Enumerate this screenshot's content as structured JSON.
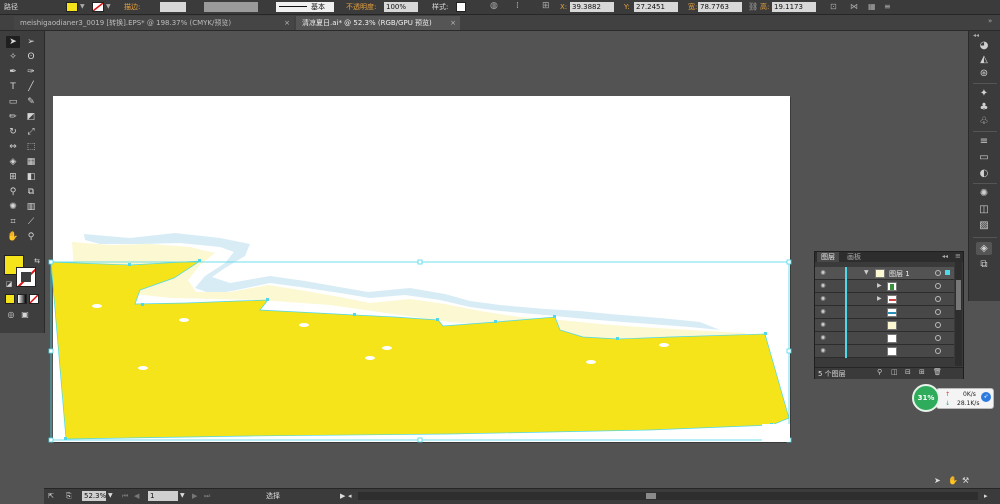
{
  "control_bar": {
    "path_label": "路径",
    "stroke_label": "描边:",
    "basic_label": "基本",
    "opacity_label": "不透明度:",
    "opacity_value": "100%",
    "style_label": "样式:",
    "x_label": "X:",
    "x_value": "39.3882",
    "y_label": "Y:",
    "y_value": "27.2451",
    "w_label": "宽:",
    "w_value": "78.7763",
    "h_label": "高:",
    "h_value": "19.1173"
  },
  "tabs": [
    {
      "label": "meishigaodianer3_0019 [转换].EPS* @ 198.37% (CMYK/预览)",
      "close": "×"
    },
    {
      "label": "清凉夏日.ai* @ 52.3% (RGB/GPU 预览)",
      "close": "×"
    }
  ],
  "layers_panel": {
    "tab_layers": "图层",
    "tab_artboards": "画板",
    "layer_name": "图层 1",
    "footer_count": "5 个图层"
  },
  "net_widget": {
    "percent": "31%",
    "upload": "0K/s",
    "download": "28.1K/s"
  },
  "status_bar": {
    "zoom": "52.3%",
    "page": "1",
    "mode": "选择"
  },
  "colors": {
    "fill": "#f5e41a",
    "artboard": "#ffffff",
    "sand_light": "#fbf8d2",
    "water": "#d8ecf6",
    "selection": "#4fd8e8"
  }
}
